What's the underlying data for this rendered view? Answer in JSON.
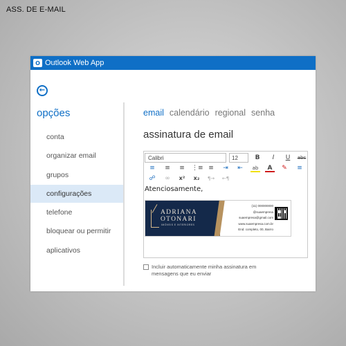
{
  "caption": "ASS. DE E-MAIL",
  "app": {
    "title": "Outlook Web App",
    "icon": "outlook-icon",
    "brand_color": "#0f6fc6"
  },
  "back_button": {
    "icon": "back-arrow-icon"
  },
  "sidebar": {
    "title": "opções",
    "items": [
      {
        "label": "conta"
      },
      {
        "label": "organizar email"
      },
      {
        "label": "grupos"
      },
      {
        "label": "configurações",
        "selected": true
      },
      {
        "label": "telefone"
      },
      {
        "label": "bloquear ou permitir"
      },
      {
        "label": "aplicativos"
      }
    ]
  },
  "tabs": [
    {
      "label": "email",
      "active": true
    },
    {
      "label": "calendário"
    },
    {
      "label": "regional"
    },
    {
      "label": "senha"
    }
  ],
  "section_title": "assinatura de email",
  "toolbar": {
    "font": "Calibri",
    "size": "12",
    "buttons": [
      "bold-icon",
      "italic-icon",
      "underline-icon",
      "strikethrough-icon",
      "align-left-icon",
      "align-center-icon",
      "align-right-icon",
      "bulleted-list-icon",
      "numbered-list-icon",
      "increase-indent-icon",
      "decrease-indent-icon",
      "highlight-icon",
      "font-color-icon",
      "clear-formatting-icon",
      "line-spacing-icon",
      "insert-link-icon",
      "remove-link-icon",
      "superscript-icon",
      "subscript-icon",
      "left-to-right-icon",
      "right-to-left-icon"
    ],
    "labels": {
      "bold": "B",
      "italic": "I",
      "underline": "U",
      "strike": "abc",
      "superscript": "x²",
      "subscript": "x₂"
    }
  },
  "editor": {
    "greeting": "Atenciosamente,",
    "signature": {
      "name_line1": "ADRIANA",
      "name_line2": "OTONARI",
      "tagline": "IMÓVEIS E INTERIORES",
      "info": [
        "(11) 000000000",
        "@suaempresa",
        "suaempresa@gmail.com",
        "www.suaempresa.com.br",
        "End. completo, 00, Bairro"
      ],
      "colors": {
        "navy": "#14294a",
        "gold": "#b7925f"
      }
    }
  },
  "checkbox": {
    "label": "Incluir automaticamente minha assinatura em mensagens que eu enviar",
    "checked": false
  }
}
